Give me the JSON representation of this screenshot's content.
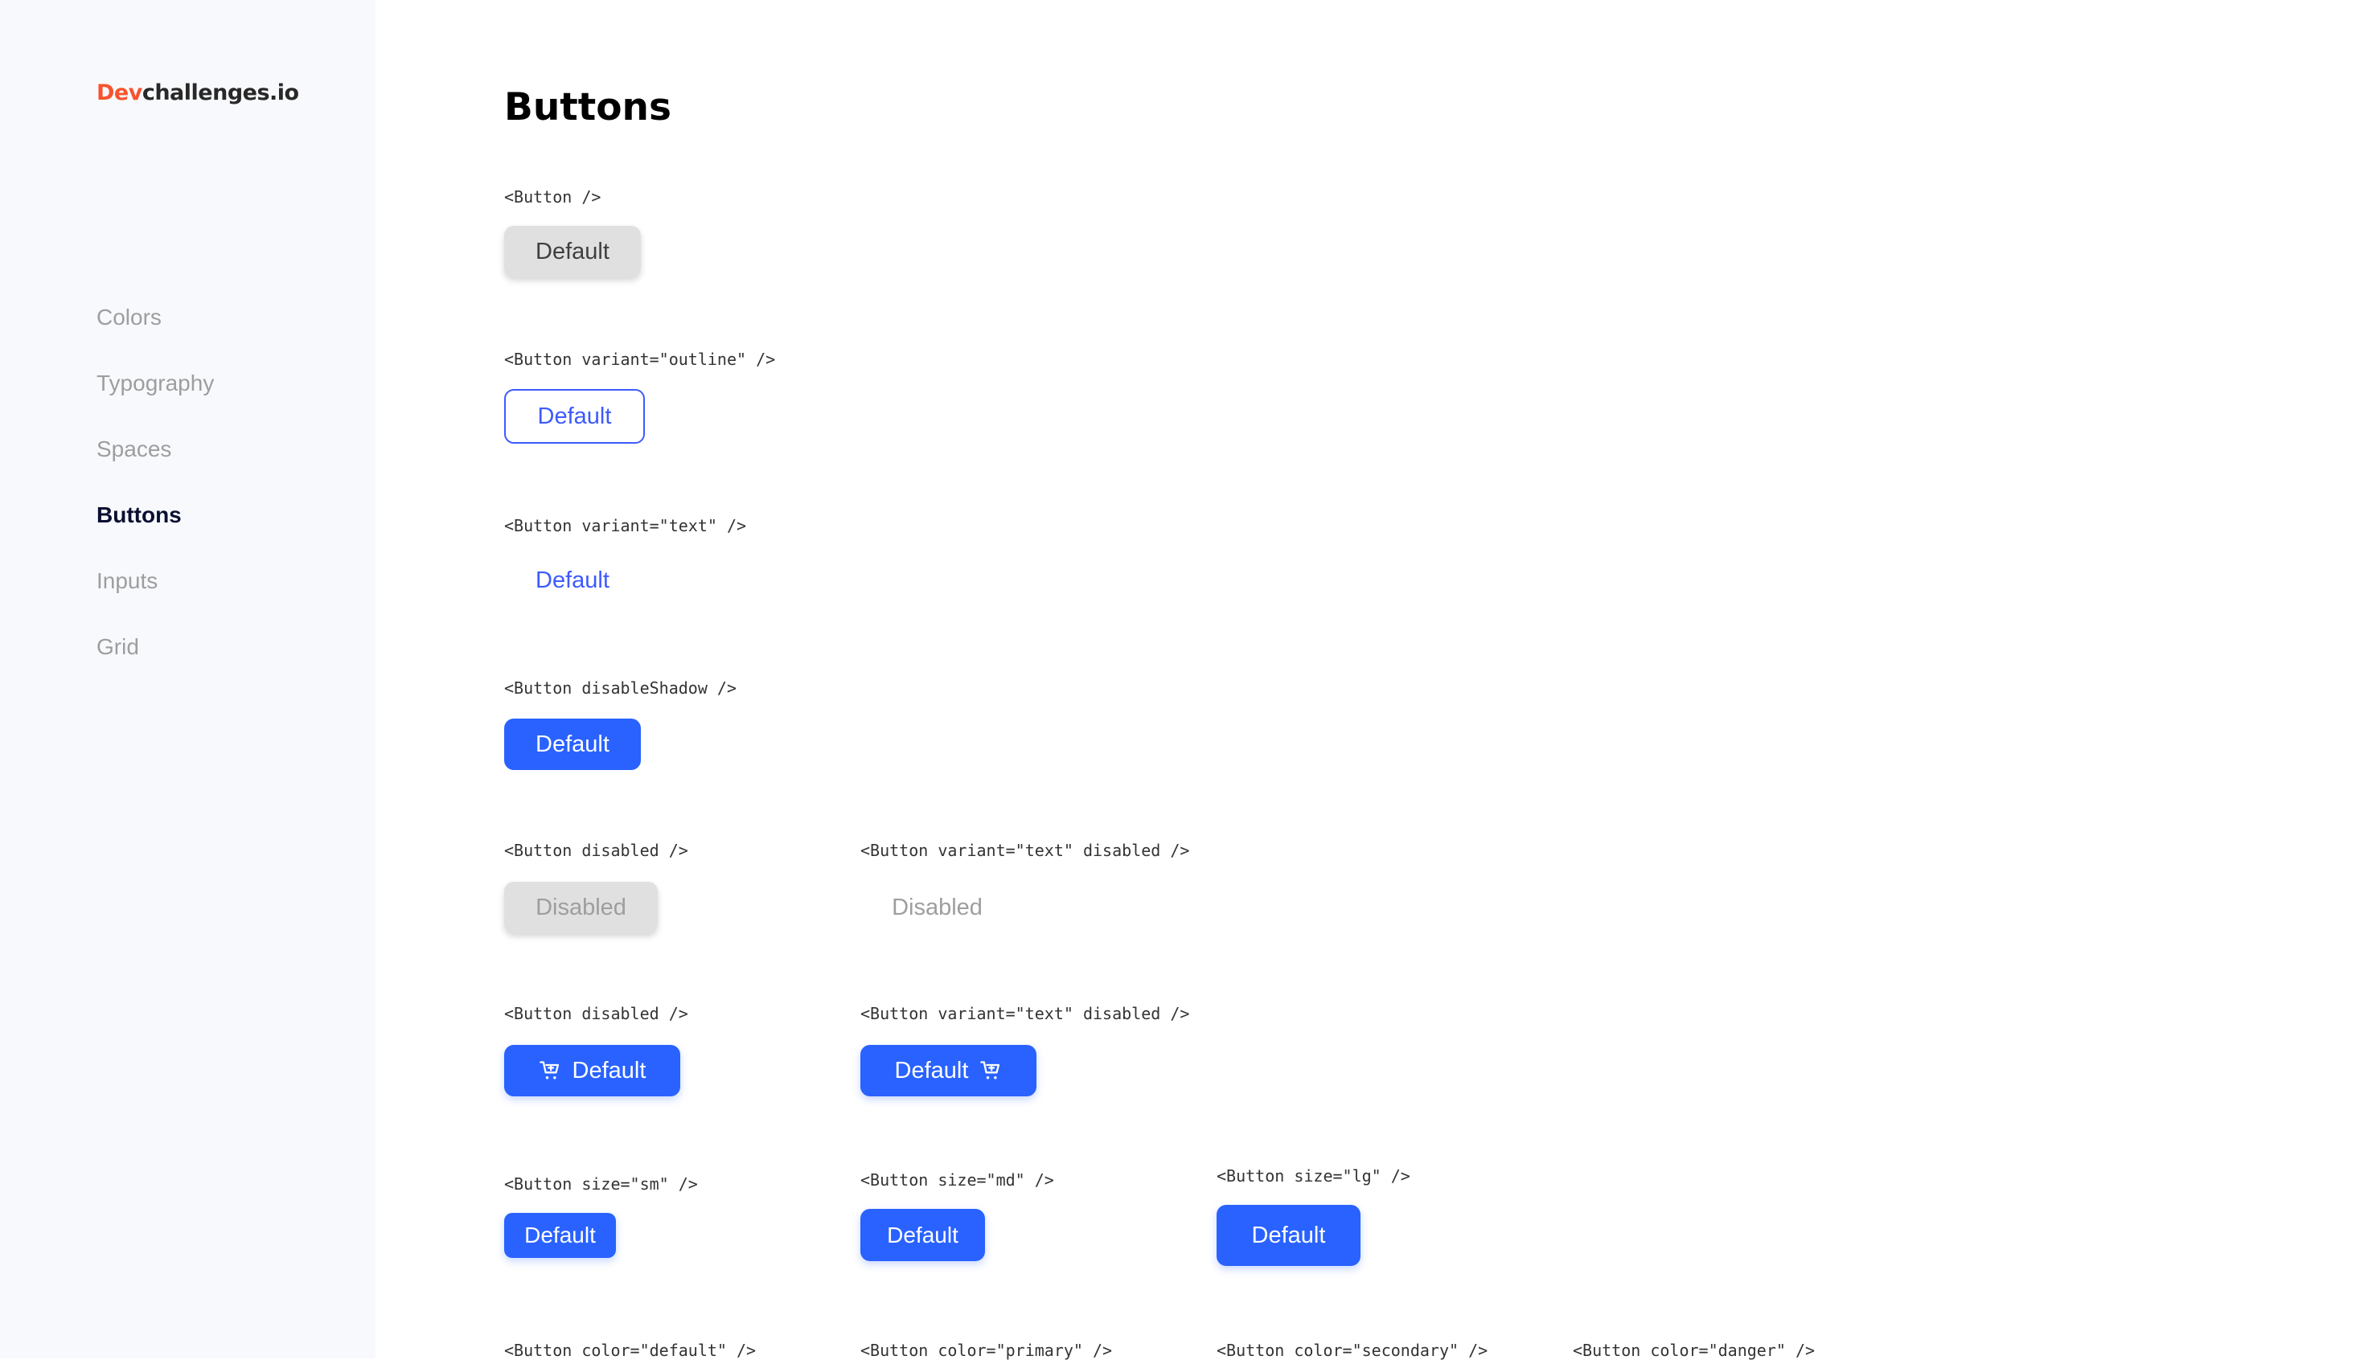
{
  "logo": {
    "accent": "Dev",
    "rest": "challenges.io"
  },
  "nav": {
    "items": [
      {
        "label": "Colors"
      },
      {
        "label": "Typography"
      },
      {
        "label": "Spaces"
      },
      {
        "label": "Buttons",
        "active": true
      },
      {
        "label": "Inputs"
      },
      {
        "label": "Grid"
      }
    ]
  },
  "page": {
    "title": "Buttons"
  },
  "examples": {
    "default": {
      "code": "<Button />",
      "label": "Default"
    },
    "outline": {
      "code": "<Button variant=\"outline\" />",
      "label": "Default"
    },
    "text": {
      "code": "<Button variant=\"text\" />",
      "label": "Default"
    },
    "disable_shadow": {
      "code": "<Button disableShadow />",
      "label": "Default"
    },
    "disabled": {
      "code": "<Button disabled />",
      "label": "Disabled"
    },
    "text_disabled": {
      "code": "<Button variant=\"text\" disabled />",
      "label": "Disabled"
    },
    "start_icon": {
      "code": "<Button disabled />",
      "label": "Default",
      "icon": "cart-icon"
    },
    "end_icon": {
      "code": "<Button variant=\"text\" disabled />",
      "label": "Default",
      "icon": "cart-icon"
    },
    "size_sm": {
      "code": "<Button size=\"sm\" />",
      "label": "Default"
    },
    "size_md": {
      "code": "<Button size=\"md\" />",
      "label": "Default"
    },
    "size_lg": {
      "code": "<Button size=\"lg\" />",
      "label": "Default"
    },
    "color_default": {
      "code": "<Button color=\"default\" />"
    },
    "color_primary": {
      "code": "<Button color=\"primary\" />"
    },
    "color_secondary": {
      "code": "<Button color=\"secondary\" />"
    },
    "color_danger": {
      "code": "<Button color=\"danger\" />"
    }
  },
  "colors": {
    "brand_accent": "#f7542e",
    "primary": "#2962ff",
    "outline": "#3d5afe",
    "default_bg": "#e0e0e0",
    "disabled_text": "#9e9e9e",
    "sidebar_bg": "#f8f9fd"
  }
}
